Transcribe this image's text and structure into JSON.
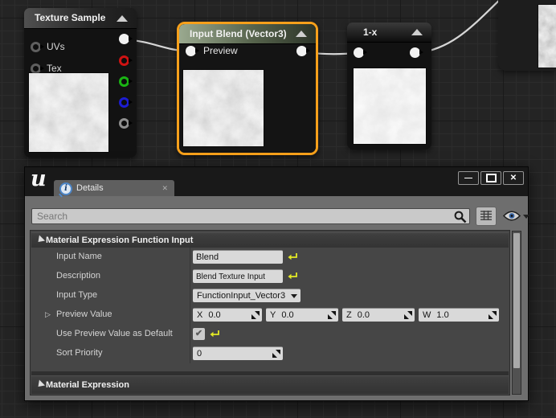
{
  "colors": {
    "selection_orange": "#F7A01B",
    "wire": "#d6d6d6",
    "pin_white": "#f2f2f2",
    "pin_red": "#cf1212",
    "pin_green": "#1ab414",
    "pin_blue": "#1d1dd1",
    "pin_gray": "#8f8f8f",
    "reset_yellow": "#e4ea25",
    "tab_icon_blue": "#4d86c8"
  },
  "graph": {
    "nodes": {
      "texture_sample": {
        "title": "Texture Sample",
        "inputs": [
          {
            "label": "UVs"
          },
          {
            "label": "Tex"
          }
        ],
        "outputs": [
          {
            "name": "rgb",
            "color": "#f2f2f2",
            "filled": true
          },
          {
            "name": "red",
            "color": "#cf1212",
            "filled": false
          },
          {
            "name": "green",
            "color": "#1ab414",
            "filled": false
          },
          {
            "name": "blue",
            "color": "#1d1dd1",
            "filled": false
          },
          {
            "name": "alpha",
            "color": "#8f8f8f",
            "filled": false
          }
        ]
      },
      "input_blend": {
        "title": "Input Blend (Vector3)",
        "input_label": "Preview",
        "selected": true
      },
      "one_minus_x": {
        "title": "1-x"
      }
    }
  },
  "details_window": {
    "tab_label": "Details",
    "tab_close_glyph": "✕",
    "window_buttons": {
      "minimize": "—",
      "close": "✕"
    },
    "search": {
      "placeholder": "Search"
    },
    "category1": {
      "title": "Material Expression Function Input"
    },
    "rows": {
      "input_name": {
        "label": "Input Name",
        "value": "Blend"
      },
      "description": {
        "label": "Description",
        "value": "Blend Texture Input"
      },
      "input_type": {
        "label": "Input Type",
        "value": "FunctionInput_Vector3"
      },
      "preview_value": {
        "label": "Preview Value",
        "expander_glyph": "▷",
        "components": [
          {
            "axis": "X",
            "value": "0.0"
          },
          {
            "axis": "Y",
            "value": "0.0"
          },
          {
            "axis": "Z",
            "value": "0.0"
          },
          {
            "axis": "W",
            "value": "1.0"
          }
        ]
      },
      "use_preview_default": {
        "label": "Use Preview Value as Default",
        "checked": true,
        "check_glyph": "✔"
      },
      "sort_priority": {
        "label": "Sort Priority",
        "value": "0"
      }
    },
    "category2": {
      "title": "Material Expression"
    }
  }
}
